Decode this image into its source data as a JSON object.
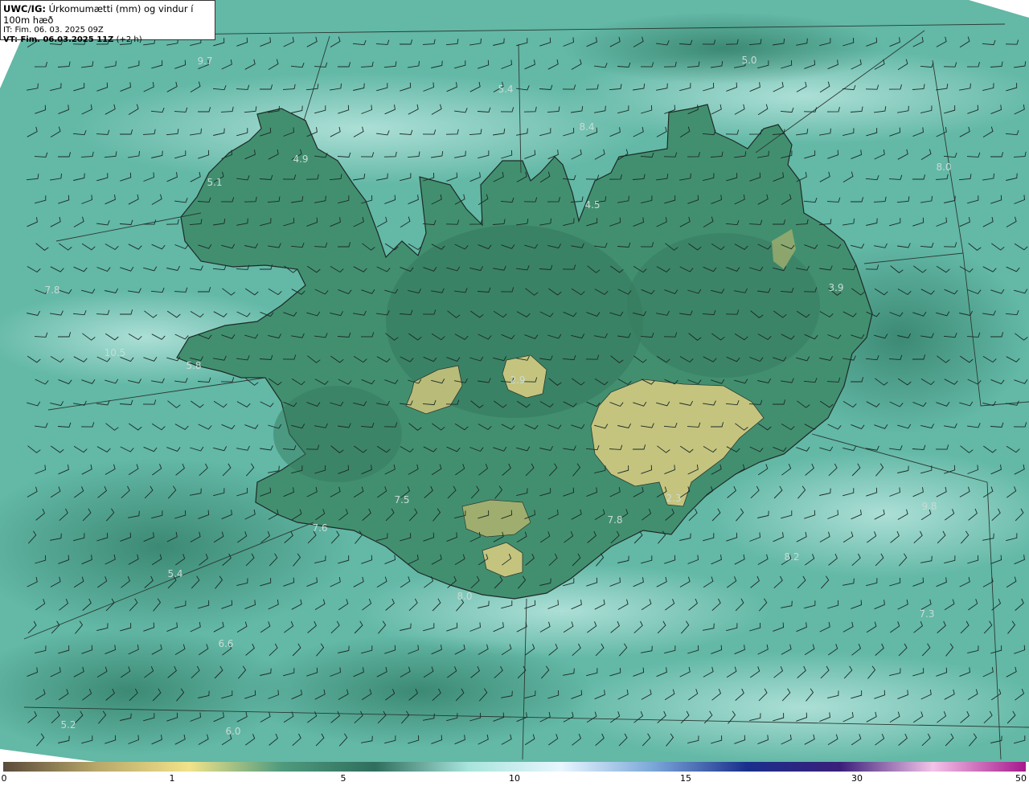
{
  "header": {
    "product_prefix": "UWC/IG:",
    "title": "Úrkomumætti (mm) og vindur í 100m hæð",
    "init_time": "IT: Fim. 06. 03. 2025 09Z",
    "valid_prefix": "VT: Fim. 06.03.2025 11Z",
    "valid_suffix": "(+2 h)"
  },
  "map": {
    "value_labels": [
      "9.7",
      "5.0",
      "5.4",
      "8.4",
      "4.9",
      "5.1",
      "4.5",
      "8.0",
      "3.9",
      "7.8",
      "10.5",
      "5.8",
      "2.9",
      "7.5",
      "7.6",
      "2.3",
      "7.8",
      "9.8",
      "5.4",
      "8.0",
      "6.6",
      "7.3",
      "5.2",
      "6.0",
      "8.2"
    ],
    "colors": {
      "sea": "#5fb5a3",
      "land": "#3f8a6c",
      "glacier": "#c7c880",
      "coast": "#1d2b25",
      "barb": "#1a2a24"
    }
  },
  "colorbar": {
    "ticks": [
      "0",
      "1",
      "5",
      "10",
      "15",
      "30",
      "50"
    ],
    "stops": [
      "#5a4a3a",
      "#b7a76a",
      "#f1e38a",
      "#4f9a7e",
      "#2f6e5d",
      "#a8e4dc",
      "#e8f6ff",
      "#7aa6d8",
      "#1a2f8c",
      "#3a1f7a",
      "#f3c3e8",
      "#a6188c"
    ]
  }
}
